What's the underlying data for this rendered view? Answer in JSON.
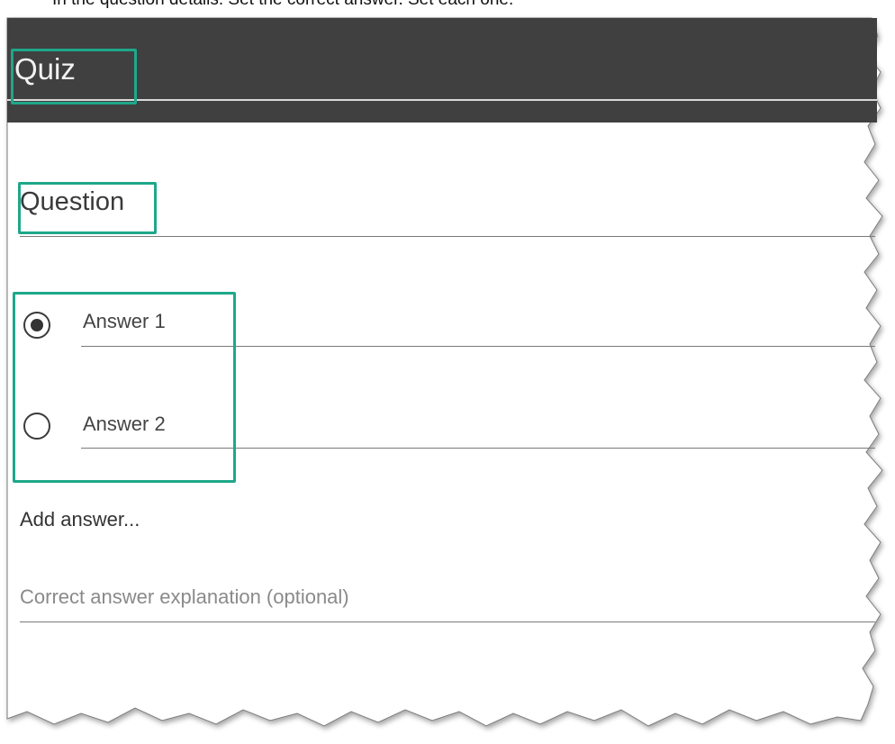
{
  "caption": {
    "text": "In the question details. Set the correct answer. Set each one."
  },
  "header": {
    "title": "Quiz"
  },
  "question": {
    "label": "Question"
  },
  "answers": [
    {
      "label": "Answer 1",
      "selected": true
    },
    {
      "label": "Answer 2",
      "selected": false
    }
  ],
  "add_answer": {
    "label": "Add answer..."
  },
  "explanation": {
    "placeholder": "Correct answer explanation (optional)"
  },
  "colors": {
    "header_bg": "#404040",
    "highlight": "#1ea88a",
    "text": "#333333",
    "placeholder": "#8a8a8a"
  }
}
